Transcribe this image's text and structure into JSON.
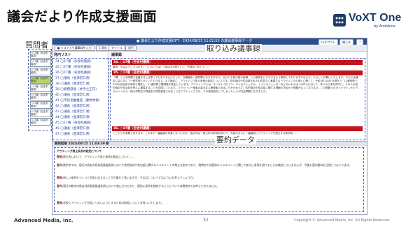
{
  "slide": {
    "title": "議会だより作成支援画面",
    "logo_text": "VoXT One",
    "logo_sub": "by AmiVoice",
    "footer_left": "Advanced Media, Inc.",
    "page_number": "32",
    "copyright": "Copyright © Advanced Media, Inc. All Rights Reserved."
  },
  "callouts": {
    "questioner": "質問者",
    "transcript": "取り込み議事録",
    "summary": "要約データ"
  },
  "app": {
    "title": "● 議会だより作成支援GPT・2024/08/15 11:02:55 の議会議事録データ",
    "title_buttons": [
      "ログアウト",
      "閉じる",
      "?"
    ],
    "toolbar": [
      "● リスト入り議事録を入力",
      "1 既存",
      "タイトル",
      "発行"
    ],
    "left_header": "発内リスト",
    "left_items": [
      "34 ◯17番（谷会村議員）",
      "35 ◯17番（谷会村議員）",
      "36 ◯17番（谷会村議員）",
      "37 ◯議長（金澤宏仁君）",
      "38 ◯議長（金澤宏仁君）",
      "39 ◯総務部長（井手之正氏）",
      "40 ◯議長（金澤宏仁君）",
      "41 ◯市民協働推進（藤原秀樹）",
      "42 ◯議長（金澤宏仁君）",
      "43 ◯議長（金澤宏仁君）",
      "44 ◯議長（金澤宏仁君）",
      "45 ◯17番（谷会村議員）",
      "46 ◯議長（金澤宏仁君）",
      "47 ◯議長（金澤宏仁君）"
    ],
    "transcript_header": "議事録",
    "speakers": [
      {
        "label": "34. ○17番（谷会村議員）",
        "text": "議長、おはようございます。（こんにちは）で始まる1問つとし、予想外に早くで……"
      },
      {
        "label": "35. ○17番（谷会村議員）",
        "text": "（標）こんな時間で会議するとは思ってもおりませんでした。今期議会一般質問になりますので、ぜひとも執行部の皆様、いい説明をいただけるよう期待しておりますけれども、よろしくお願いいたします。それでは通告に従いまして一般質問させていただきます。まず最初に、アウティング禁止条例の制定についてです。性的指向や性自認を本人の同意なく暴露するアウティングの禁止に関して、令和3年10月1日現在で、12都府県で253の自治体が条例で規定し、11道府県で要綱等を策定しています。アウティングとは、ゲイやレズビアン、バイセクシュアル、トランスジェンダーなどのいわゆる LGBTQに対して、本人の了承を得ずに、その人の性的指向や性自認を他人に暴露することを意味しています。プライバシー侵害の重大な人権侵害であるにもかかわらず、性的指向や性自認に関する理解の不足から問題が生じております。この問題でのガイドラインやクラスメイトから一橋大学院生が同級生の同性愛者であることをアウティングされ、その後自殺をしてしまったことが社会問題となりました。"
      },
      {
        "label": "36. ○17番（谷会村議員）",
        "text": "ここからが本題となります。この中で一番議論の対象となったのが、国立市は一般公布の条例を設けて、市民の方々に一番最初にアウティングを禁止する条例を……"
      }
    ],
    "summary_header": "要約結果 2024/08/15 11:03:39 新",
    "summary_title": "アウティング禁止条例の制定について",
    "summary_lines": [
      {
        "who": "質問:",
        "text": "数字市において、アウティング禁止条例の制定について……"
      },
      {
        "who": "答弁:",
        "text": "数字市では、現行の男女共同参画推進条例において性的指向や性自認に関するハラスメントの禁止を定めており、現時点では個別のハラスメントに関して新たに条例を設けることは検討していませんが、今後も国の動向を注視してまいります。"
      },
      {
        "who": "質問:",
        "text": "新しい条例をつくって市民に伝えることが大事だと思いますが、その点についてどのようにお考えでしょうか。"
      },
      {
        "who": "答弁:",
        "text": "現行の数字市男女共同参画推進条例において禁止されており、個別に条例を制定することについては現時点では考えておりません。"
      },
      {
        "who": "質問:",
        "text": "学校でアウティングが起こらないようにするための取組についてお伺いいたします。"
      }
    ]
  },
  "questioner_items": [
    "○17番（谷会村議員）",
    "○17番（谷会村議員）",
    "○17番（谷会村議員）",
    "○17番（谷会村議員）",
    "○17番（谷会村議員）",
    "○17番（谷会村議員）",
    "○17番（谷会村議員）",
    "○17番（谷会村議員）",
    "○17番（谷会村議員）"
  ],
  "colors": {
    "accent_red": "#c2141b",
    "titlebar_blue": "#2d4f8e",
    "active_green": "#b8d36a"
  }
}
